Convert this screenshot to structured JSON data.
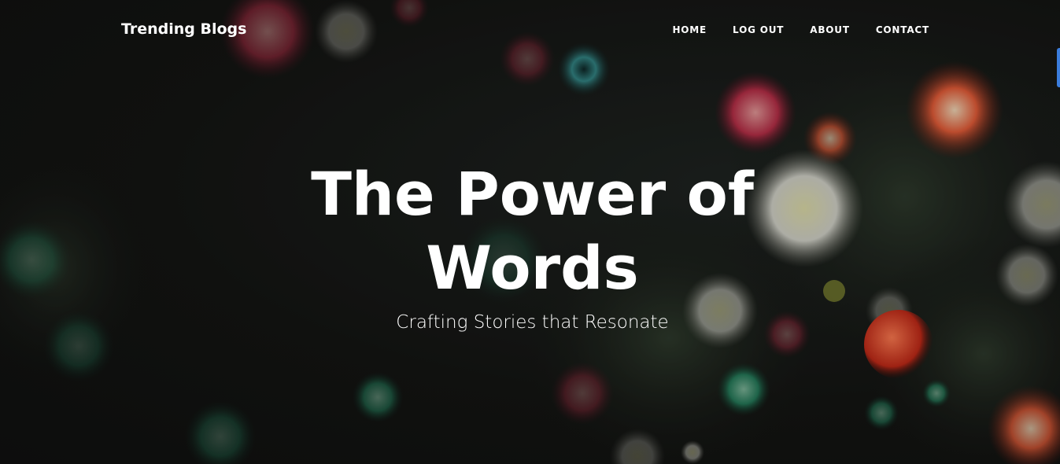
{
  "header": {
    "brand": "Trending Blogs",
    "nav": [
      "HOME",
      "LOG OUT",
      "ABOUT",
      "CONTACT"
    ]
  },
  "hero": {
    "title_line1": "The Power of",
    "title_line2": "Words",
    "subtitle": "Crafting Stories that Resonate",
    "background_image": "coral-anemones-photo"
  },
  "colors": {
    "text": "#ffffff",
    "background": "#151514",
    "side_tab": "#3b7ddd"
  }
}
